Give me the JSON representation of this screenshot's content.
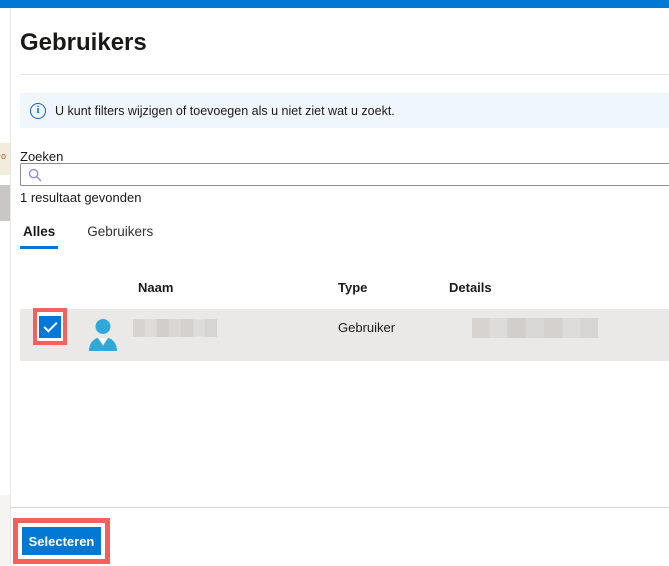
{
  "page": {
    "title": "Gebruikers"
  },
  "banner": {
    "text": "U kunt filters wijzigen of toevoegen als u niet ziet wat u zoekt."
  },
  "search": {
    "label": "Zoeken",
    "value": "",
    "placeholder": "",
    "results_text": "1 resultaat gevonden"
  },
  "tabs": {
    "all": "Alles",
    "users": "Gebruikers",
    "selected": "Alles"
  },
  "table": {
    "columns": {
      "name": "Naam",
      "type": "Type",
      "details": "Details"
    },
    "row": {
      "type": "Gebruiker",
      "selected": true,
      "name_redacted": true,
      "details_redacted": true
    }
  },
  "footer": {
    "select_label": "Selecteren"
  },
  "background": {
    "text_fragment": "o"
  },
  "icons": {
    "info_glyph": "i",
    "names": [
      "info-icon",
      "search-icon",
      "person-icon",
      "checkmark-icon"
    ]
  },
  "colors": {
    "accent_blue": "#0078d4",
    "checkbox_blue": "#0078d7",
    "annotation_red": "#f4615c",
    "banner_bg": "#eff6fc",
    "row_bg": "#ebe9e7",
    "person_icon_blue": "#2fa9dc",
    "top_bar_blue": "#0078d4"
  }
}
